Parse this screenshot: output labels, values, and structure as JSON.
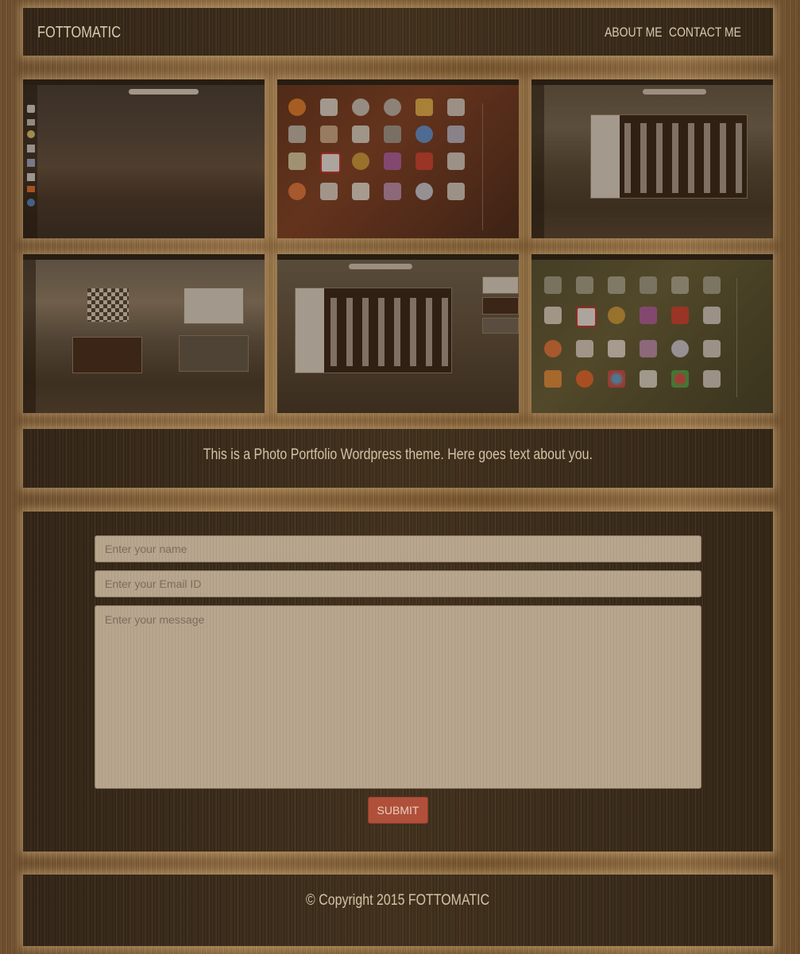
{
  "header": {
    "brand": "FOTTOMATIC",
    "nav": [
      {
        "label": "ABOUT ME"
      },
      {
        "label": "CONTACT ME"
      }
    ]
  },
  "gallery": {
    "thumbnails": [
      {
        "name": "thumb-desktop-activities"
      },
      {
        "name": "thumb-app-grid-warm"
      },
      {
        "name": "thumb-app-window-sunset"
      },
      {
        "name": "thumb-workspace-overview"
      },
      {
        "name": "thumb-app-window-dock"
      },
      {
        "name": "thumb-app-grid-green"
      }
    ]
  },
  "about": {
    "text": "This is a Photo Portfolio Wordpress theme. Here goes text about you."
  },
  "contact": {
    "name_placeholder": "Enter your name",
    "email_placeholder": "Enter your Email ID",
    "message_placeholder": "Enter your message",
    "submit_label": "SUBMIT"
  },
  "footer": {
    "copyright": "© Copyright 2015 FOTTOMATIC"
  },
  "colors": {
    "panel": "#3b2c1e",
    "wood": "#7a5a35",
    "submit": "#b0503a",
    "text": "#d9c9ad"
  }
}
